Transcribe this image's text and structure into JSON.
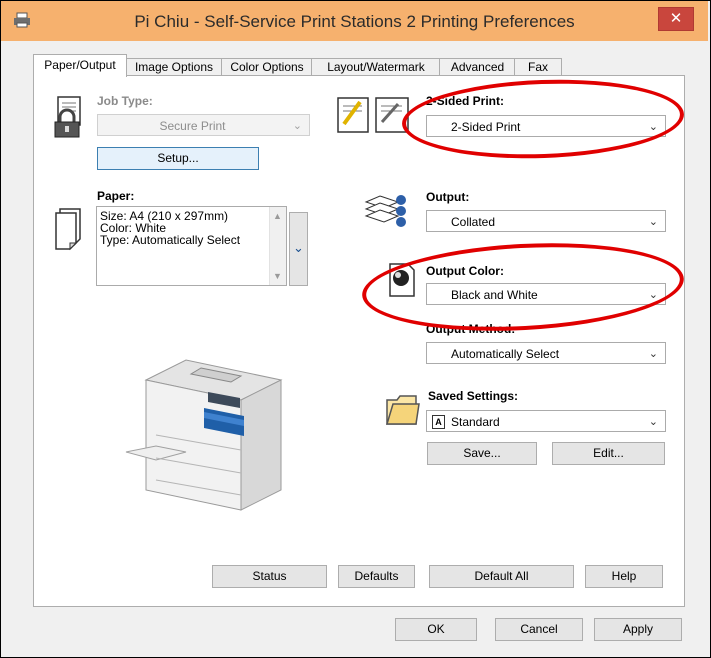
{
  "window": {
    "title": "Pi Chiu - Self-Service Print Stations 2 Printing Preferences",
    "close_glyph": "✕"
  },
  "tabs": [
    {
      "label": "Paper/Output",
      "active": true
    },
    {
      "label": "Image Options"
    },
    {
      "label": "Color Options"
    },
    {
      "label": "Layout/Watermark"
    },
    {
      "label": "Advanced"
    },
    {
      "label": "Fax"
    }
  ],
  "job_type": {
    "label": "Job Type:",
    "value": "Secure Print",
    "setup_button": "Setup..."
  },
  "paper": {
    "label": "Paper:",
    "lines": [
      "Size: A4 (210 x 297mm)",
      "Color: White",
      "Type: Automatically Select"
    ]
  },
  "two_sided": {
    "label": "2-Sided Print:",
    "value": "2-Sided Print"
  },
  "output": {
    "label": "Output:",
    "value": "Collated"
  },
  "output_color": {
    "label": "Output Color:",
    "value": "Black and White"
  },
  "output_method": {
    "label": "Output Method:",
    "value": "Automatically Select"
  },
  "saved_settings": {
    "label": "Saved Settings:",
    "value": "Standard",
    "badge": "A",
    "save_button": "Save...",
    "edit_button": "Edit..."
  },
  "bottom_buttons": {
    "status": "Status",
    "defaults": "Defaults",
    "default_all": "Default All",
    "help": "Help"
  },
  "dialog_buttons": {
    "ok": "OK",
    "cancel": "Cancel",
    "apply": "Apply"
  },
  "icons": {
    "app": "printer-icon",
    "job": "lock-document-icon",
    "paper": "paper-stack-icon",
    "duplex": "duplex-pages-icon",
    "output": "collate-icon",
    "color": "output-color-icon",
    "saved": "folder-icon",
    "printer_image": "multifunction-printer-image"
  },
  "colors": {
    "titlebar": "#f6b16e",
    "close": "#c9463d",
    "annotation": "#e00000"
  }
}
